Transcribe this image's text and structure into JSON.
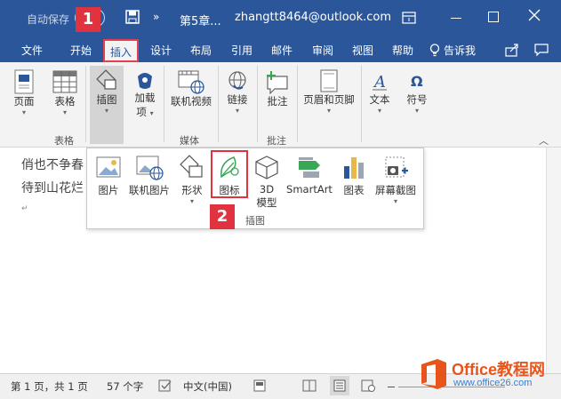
{
  "titlebar": {
    "autosave": "自动保存",
    "autosave_state": "关",
    "more": "»",
    "doc_title": "第5章...",
    "account": "zhangtt8464@outlook.com"
  },
  "tabs": [
    "文件",
    "开始",
    "插入",
    "设计",
    "布局",
    "引用",
    "邮件",
    "审阅",
    "视图",
    "帮助"
  ],
  "tell_me": "告诉我",
  "ribbon": {
    "page": "页面",
    "table": "表格",
    "table_group": "表格",
    "illustrations": "插图",
    "addins_line1": "加载",
    "addins_line2": "项",
    "online_video": "联机视频",
    "media_group": "媒体",
    "link": "链接",
    "comment": "批注",
    "comment_group": "批注",
    "header_footer": "页眉和页脚",
    "text": "文本",
    "symbol": "符号"
  },
  "popup": {
    "pictures": "图片",
    "online_pictures": "联机图片",
    "shapes": "形状",
    "icons": "图标",
    "model_line1": "3D",
    "model_line2": "模型",
    "smartart": "SmartArt",
    "chart": "图表",
    "screenshot": "屏幕截图",
    "group_label": "插图"
  },
  "badges": [
    "1",
    "2"
  ],
  "document": {
    "line1": "俏也不争春",
    "line2": "待到山花烂",
    "para_mark": "↵"
  },
  "status": {
    "page": "第 1 页，共 1 页",
    "words": "57 个字",
    "language": "中文(中国)"
  },
  "watermark": {
    "brand": "Office教程网",
    "url": "www.office26.com"
  },
  "colors": {
    "titlebar": "#2b579a",
    "ribbon": "#f3f3f3",
    "highlight": "#e0323f",
    "watermark": "#e8551c"
  }
}
